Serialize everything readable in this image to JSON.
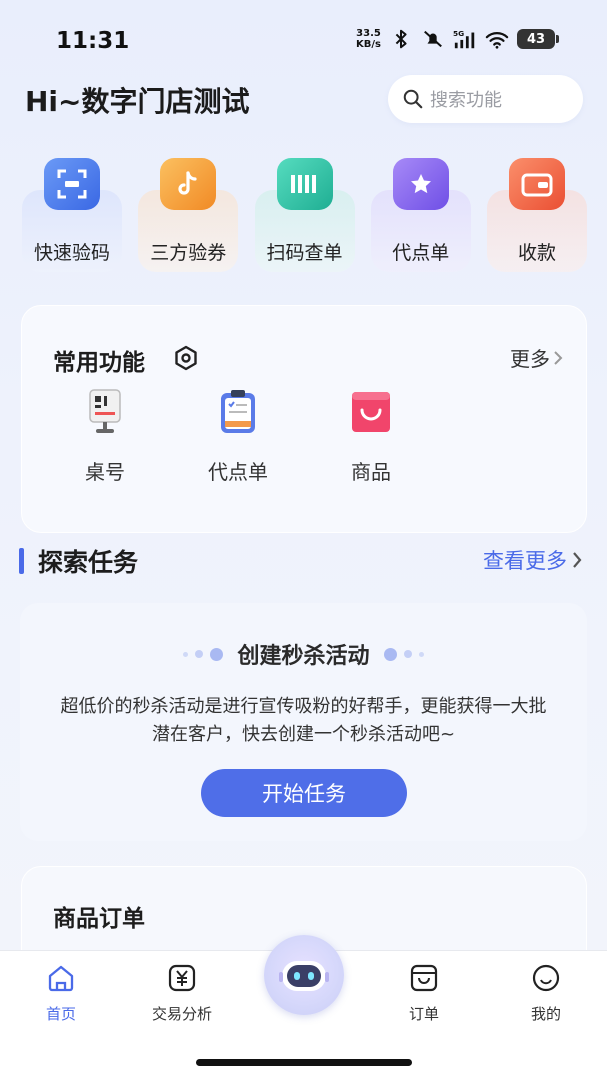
{
  "status_bar": {
    "time": "11:31",
    "net_speed_value": "33.5",
    "net_speed_unit": "KB/s",
    "network": "5G",
    "battery": "43"
  },
  "header": {
    "greeting": "Hi~数字门店测试",
    "search_placeholder": "搜索功能"
  },
  "quick_actions": [
    {
      "label": "快速验码",
      "icon": "scan-code-icon",
      "color": "#4b7df0"
    },
    {
      "label": "三方验券",
      "icon": "douyin-ticket-icon",
      "color": "#f7a43b"
    },
    {
      "label": "扫码查单",
      "icon": "scan-order-icon",
      "color": "#2fc3a9"
    },
    {
      "label": "代点单",
      "icon": "star-order-icon",
      "color": "#8d6cf0"
    },
    {
      "label": "收款",
      "icon": "wallet-icon",
      "color": "#f36e4d"
    }
  ],
  "common_functions": {
    "title": "常用功能",
    "more": "更多",
    "items": [
      {
        "label": "桌号",
        "icon": "table-number-icon"
      },
      {
        "label": "代点单",
        "icon": "clipboard-order-icon"
      },
      {
        "label": "商品",
        "icon": "shopping-bag-icon"
      }
    ]
  },
  "explore": {
    "title": "探索任务",
    "more": "查看更多",
    "task": {
      "heading": "创建秒杀活动",
      "description": "超低价的秒杀活动是进行宣传吸粉的好帮手，更能获得一大批潜在客户，快去创建一个秒杀活动吧~",
      "button": "开始任务"
    }
  },
  "orders": {
    "title": "商品订单"
  },
  "bottom_nav": {
    "accent": "#4a6ae8",
    "items": [
      {
        "label": "首页",
        "icon": "home-icon",
        "active": true
      },
      {
        "label": "交易分析",
        "icon": "yen-icon",
        "active": false
      },
      {
        "label": "",
        "icon": "robot-assistant-icon",
        "active": false
      },
      {
        "label": "订单",
        "icon": "order-icon",
        "active": false
      },
      {
        "label": "我的",
        "icon": "smile-icon",
        "active": false
      }
    ]
  }
}
